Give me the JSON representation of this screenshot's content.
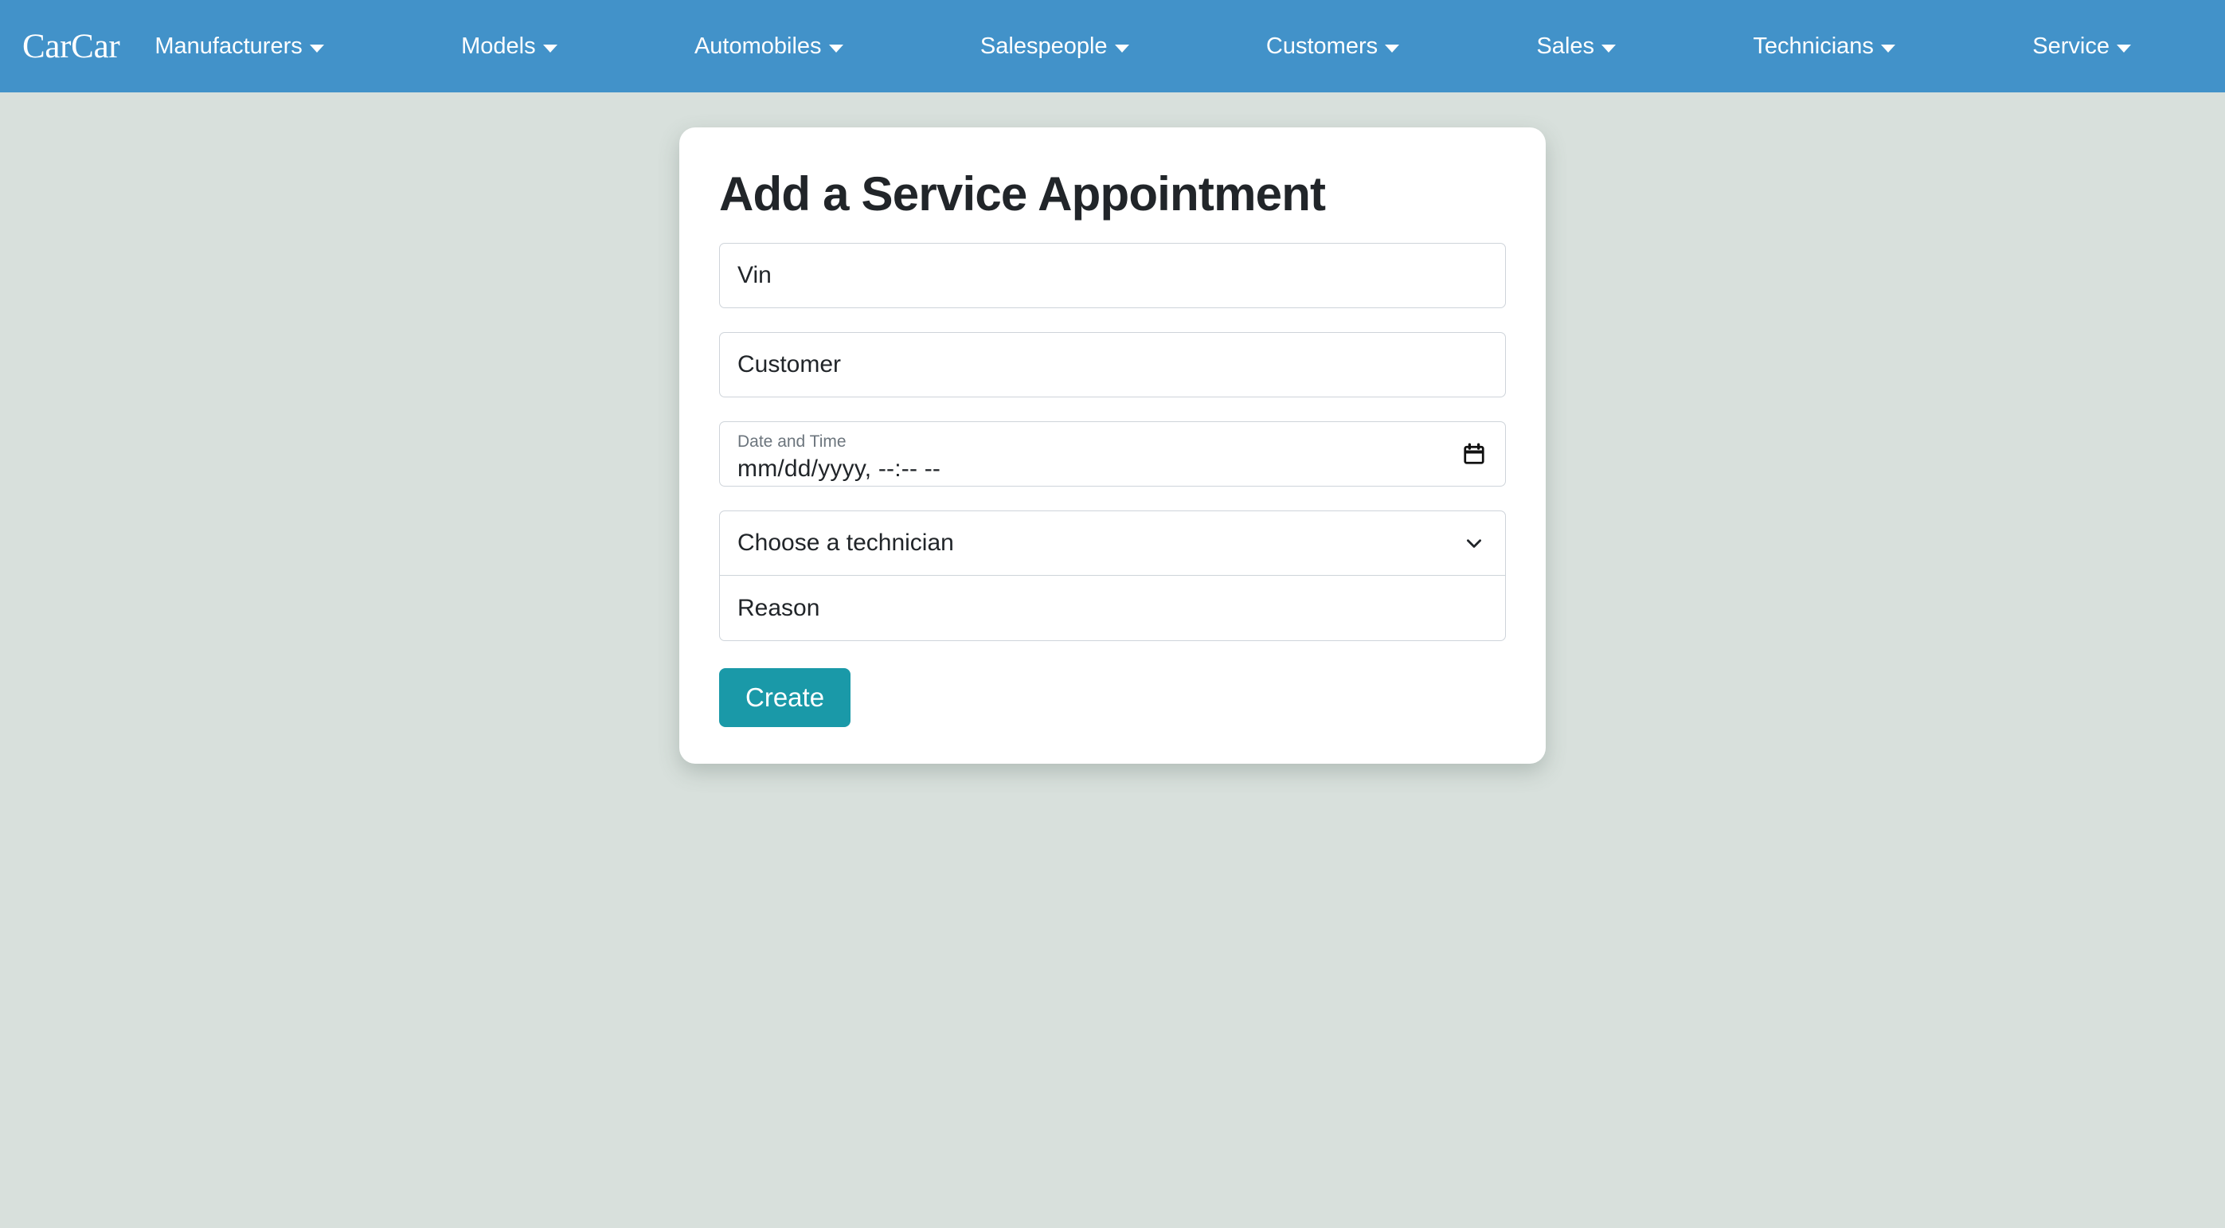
{
  "navbar": {
    "brand": "CarCar",
    "background_color": "#4292c9",
    "items": [
      {
        "label": "Manufacturers",
        "icon": "caret-down-icon"
      },
      {
        "label": "Models",
        "icon": "caret-down-icon"
      },
      {
        "label": "Automobiles",
        "icon": "caret-down-icon"
      },
      {
        "label": "Salespeople",
        "icon": "caret-down-icon"
      },
      {
        "label": "Customers",
        "icon": "caret-down-icon"
      },
      {
        "label": "Sales",
        "icon": "caret-down-icon"
      },
      {
        "label": "Technicians",
        "icon": "caret-down-icon"
      },
      {
        "label": "Service",
        "icon": "caret-down-icon"
      }
    ]
  },
  "page": {
    "background_color": "#d8e0dc"
  },
  "form": {
    "title": "Add a Service Appointment",
    "vin": {
      "placeholder": "Vin",
      "value": ""
    },
    "customer": {
      "placeholder": "Customer",
      "value": ""
    },
    "datetime": {
      "label": "Date and Time",
      "value": "mm/dd/yyyy, --:-- --",
      "icon": "calendar-icon"
    },
    "technician": {
      "selected": "Choose a technician",
      "icon": "chevron-down-icon"
    },
    "reason": {
      "placeholder": "Reason",
      "value": ""
    },
    "submit": {
      "label": "Create",
      "color": "#1a99a8"
    }
  }
}
